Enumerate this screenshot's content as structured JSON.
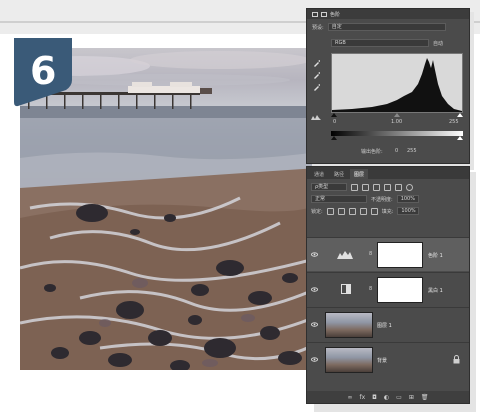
{
  "step_number": "6",
  "properties_panel": {
    "title": "色阶",
    "preset_label": "预设:",
    "preset_value": "自定",
    "channel_value": "RGB",
    "auto_button": "自动",
    "input_shadow": "0",
    "input_midtone": "1.00",
    "input_highlight": "255",
    "output_label": "输出色阶:",
    "output_low": "0",
    "output_high": "255"
  },
  "layers_panel": {
    "tabs": [
      "通道",
      "路径",
      "图层"
    ],
    "active_tab": "图层",
    "kind_filter": "ρ类型",
    "blend_mode": "正常",
    "opacity_label": "不透明度:",
    "opacity_value": "100%",
    "lock_label": "锁定:",
    "fill_label": "填充:",
    "fill_value": "100%",
    "layers": [
      {
        "name": "色阶 1",
        "type": "adjustment-levels",
        "selected": true
      },
      {
        "name": "黑白 1",
        "type": "adjustment-bw",
        "selected": false
      },
      {
        "name": "图层 1",
        "type": "image",
        "selected": false
      },
      {
        "name": "背景",
        "type": "background",
        "selected": false,
        "locked": true
      }
    ],
    "bottom_icons": [
      "link-icon",
      "fx-icon",
      "mask-icon",
      "adjustment-icon",
      "group-icon",
      "new-layer-icon",
      "trash-icon"
    ],
    "fx_label": "fx"
  },
  "colors": {
    "panel_bg": "#4b4b4b",
    "badge_blue": "#3a5a78"
  }
}
